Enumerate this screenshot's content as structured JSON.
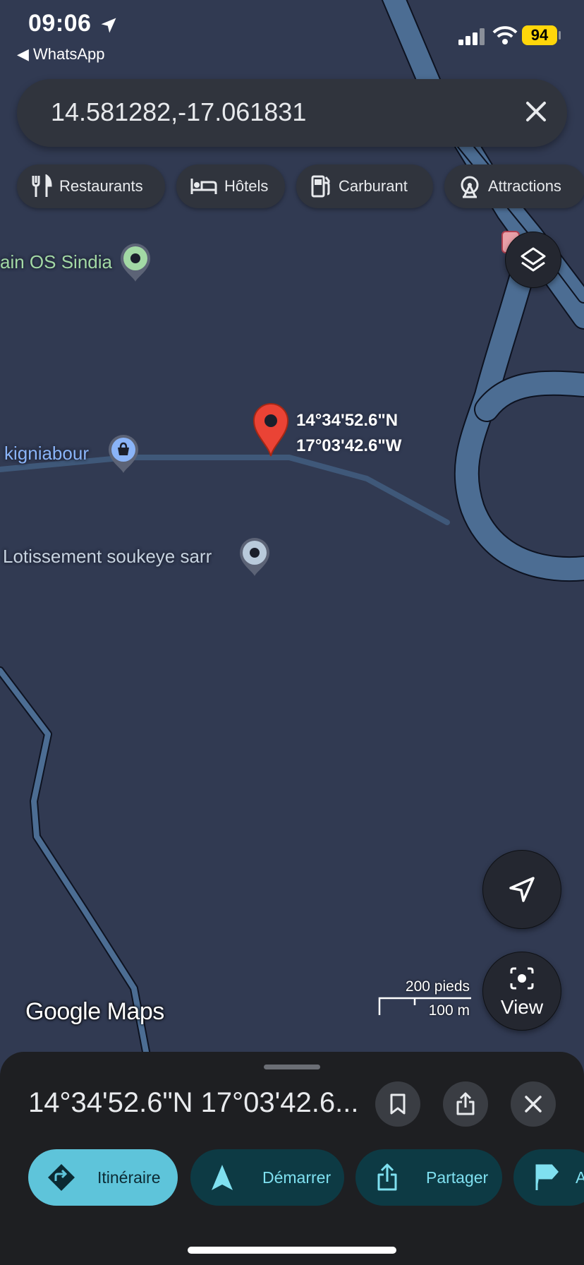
{
  "status_bar": {
    "time": "09:06",
    "back_app": "◀ WhatsApp",
    "battery": "94"
  },
  "search": {
    "value": "14.581282,-17.061831",
    "clear_icon": "close-icon"
  },
  "chips": [
    {
      "label": "Restaurants",
      "icon": "fork-knife-icon"
    },
    {
      "label": "Hôtels",
      "icon": "bed-icon"
    },
    {
      "label": "Carburant",
      "icon": "fuel-pump-icon"
    },
    {
      "label": "Attractions",
      "icon": "ferris-wheel-icon"
    }
  ],
  "map": {
    "labels": {
      "os_sindia": "ain OS Sindia",
      "kigniabour": "kigniabour",
      "lotissement": "Lotissement soukeye sarr",
      "pin_lat": "14°34'52.6\"N",
      "pin_lng": "17°03'42.6\"W"
    },
    "watermark": "Google Maps",
    "scale": {
      "feet": "200 pieds",
      "meters": "100 m"
    },
    "view_button": "View",
    "colors": {
      "background": "#313a52",
      "road": "#4c6d93",
      "pin": "#ea4335"
    }
  },
  "sheet": {
    "title": "14°34'52.6\"N 17°03'42.6...",
    "actions": [
      {
        "label": "Itinéraire",
        "icon": "directions-icon"
      },
      {
        "label": "Démarrer",
        "icon": "navigation-arrow-icon"
      },
      {
        "label": "Partager",
        "icon": "share-icon"
      },
      {
        "label": "A",
        "icon": "flag-icon"
      }
    ],
    "colors": {
      "primary_action": "#5ec4da",
      "secondary_action": "#0d3a44",
      "secondary_text": "#7fe0f0"
    }
  }
}
